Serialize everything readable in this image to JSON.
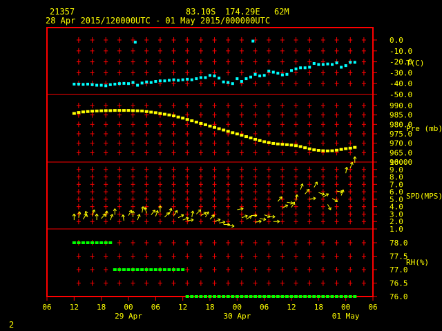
{
  "header": {
    "station_id": "21357",
    "latitude": "83.10S",
    "longitude": "174.29E",
    "elevation": "62M",
    "time_range": "28 Apr 2015/120000UTC - 01 May 2015/000000UTC"
  },
  "page_number": "2",
  "colors": {
    "frame": "#ff0000",
    "grid": "#ff0000",
    "tick_text": "#ffff00",
    "temperature": "#00ffff",
    "pressure": "#ffff00",
    "wind": "#ffff00",
    "humidity": "#00ff00"
  },
  "chart_data": {
    "type": "scatter",
    "x_axis": {
      "unit": "hours since 28 Apr 2015 00UTC",
      "range": [
        6,
        78
      ],
      "tick_values": [
        6,
        12,
        18,
        24,
        30,
        36,
        42,
        48,
        54,
        60,
        66,
        72,
        78
      ],
      "tick_labels": [
        "06",
        "12",
        "18",
        "00",
        "06",
        "12",
        "18",
        "00",
        "06",
        "12",
        "18",
        "00",
        "06"
      ],
      "date_labels": [
        {
          "text": "29 Apr",
          "x": 24
        },
        {
          "text": "30 Apr",
          "x": 48
        },
        {
          "text": "01 May",
          "x": 72
        }
      ]
    },
    "panels": [
      {
        "id": "temperature",
        "label": "T(C)",
        "ylim": [
          -50,
          0
        ],
        "tick_labels": [
          "0.0",
          "-10.0",
          "-20.0",
          "-30.0",
          "-40.0",
          "-50.0"
        ],
        "tick_values": [
          0,
          -10,
          -20,
          -30,
          -40,
          -50
        ],
        "series": [
          [
            12,
            -40.5
          ],
          [
            13,
            -40.5
          ],
          [
            14,
            -40.8
          ],
          [
            15,
            -40.5
          ],
          [
            16,
            -41
          ],
          [
            17,
            -41.5
          ],
          [
            18,
            -41.5
          ],
          [
            19,
            -42
          ],
          [
            20,
            -41
          ],
          [
            21,
            -40.5
          ],
          [
            22,
            -40
          ],
          [
            23,
            -39.8
          ],
          [
            24,
            -40
          ],
          [
            25,
            -39
          ],
          [
            25.5,
            -2
          ],
          [
            26,
            -41.5
          ],
          [
            27,
            -39.5
          ],
          [
            28,
            -38.5
          ],
          [
            29,
            -39
          ],
          [
            30,
            -38
          ],
          [
            31,
            -37.5
          ],
          [
            32,
            -37.5
          ],
          [
            33,
            -37
          ],
          [
            34,
            -36.5
          ],
          [
            35,
            -37
          ],
          [
            36,
            -36.5
          ],
          [
            37,
            -36
          ],
          [
            38,
            -36.5
          ],
          [
            39,
            -35.5
          ],
          [
            40,
            -34.5
          ],
          [
            41,
            -34.5
          ],
          [
            42,
            -32.5
          ],
          [
            43,
            -33
          ],
          [
            44,
            -35
          ],
          [
            45,
            -38.5
          ],
          [
            46,
            -39
          ],
          [
            47,
            -40
          ],
          [
            48,
            -35.5
          ],
          [
            49,
            -38
          ],
          [
            50,
            -35.5
          ],
          [
            51,
            -34
          ],
          [
            51.5,
            -1
          ],
          [
            52,
            -31.5
          ],
          [
            53,
            -33
          ],
          [
            54,
            -32.5
          ],
          [
            55,
            -28.5
          ],
          [
            56,
            -29.5
          ],
          [
            57,
            -30.5
          ],
          [
            58,
            -32
          ],
          [
            59,
            -31.5
          ],
          [
            60,
            -28
          ],
          [
            61,
            -26.5
          ],
          [
            62,
            -25.5
          ],
          [
            63,
            -25.5
          ],
          [
            64,
            -25
          ],
          [
            65,
            -21.5
          ],
          [
            66,
            -22.5
          ],
          [
            67,
            -22.5
          ],
          [
            68,
            -22
          ],
          [
            69,
            -22.5
          ],
          [
            70,
            -21
          ],
          [
            71,
            -25
          ],
          [
            72,
            -23.5
          ],
          [
            73,
            -20.5
          ],
          [
            74,
            -20.5
          ]
        ]
      },
      {
        "id": "pressure",
        "label": "Pre (mb)",
        "ylim": [
          955,
          995
        ],
        "tick_labels": [
          "990.0",
          "985.0",
          "980.0",
          "975.0",
          "970.0",
          "965.0",
          "960.0"
        ],
        "tick_values": [
          990,
          985,
          980,
          975,
          970,
          965,
          960
        ],
        "series": [
          [
            12,
            985.8
          ],
          [
            13,
            986.3
          ],
          [
            14,
            986.6
          ],
          [
            15,
            986.8
          ],
          [
            16,
            987
          ],
          [
            17,
            987.1
          ],
          [
            18,
            987.2
          ],
          [
            19,
            987.3
          ],
          [
            20,
            987.3
          ],
          [
            21,
            987.4
          ],
          [
            22,
            987.4
          ],
          [
            23,
            987.4
          ],
          [
            24,
            987.4
          ],
          [
            25,
            987.3
          ],
          [
            26,
            987.2
          ],
          [
            27,
            987.1
          ],
          [
            28,
            986.8
          ],
          [
            29,
            986.5
          ],
          [
            30,
            986.2
          ],
          [
            31,
            985.8
          ],
          [
            32,
            985.4
          ],
          [
            33,
            985
          ],
          [
            34,
            984.5
          ],
          [
            35,
            983.9
          ],
          [
            36,
            983.3
          ],
          [
            37,
            982.6
          ],
          [
            38,
            981.9
          ],
          [
            39,
            981.2
          ],
          [
            40,
            980.5
          ],
          [
            41,
            979.8
          ],
          [
            42,
            979.1
          ],
          [
            43,
            978.4
          ],
          [
            44,
            977.7
          ],
          [
            45,
            977
          ],
          [
            46,
            976.3
          ],
          [
            47,
            975.6
          ],
          [
            48,
            974.9
          ],
          [
            49,
            974.2
          ],
          [
            50,
            973.5
          ],
          [
            51,
            972.8
          ],
          [
            52,
            972.1
          ],
          [
            53,
            971.4
          ],
          [
            54,
            970.8
          ],
          [
            55,
            970.3
          ],
          [
            56,
            969.9
          ],
          [
            57,
            969.6
          ],
          [
            58,
            969.4
          ],
          [
            59,
            969.2
          ],
          [
            60,
            969
          ],
          [
            61,
            968.7
          ],
          [
            62,
            968.2
          ],
          [
            63,
            967.6
          ],
          [
            64,
            967
          ],
          [
            65,
            966.5
          ],
          [
            66,
            966.2
          ],
          [
            67,
            966
          ],
          [
            68,
            965.9
          ],
          [
            69,
            966
          ],
          [
            70,
            966.3
          ],
          [
            71,
            966.7
          ],
          [
            72,
            967.1
          ],
          [
            73,
            967.4
          ],
          [
            74,
            967.8
          ]
        ]
      },
      {
        "id": "wind",
        "label": "SPD(MPS)",
        "ylim": [
          0.5,
          10.5
        ],
        "tick_labels": [
          "10.0",
          "9.0",
          "8.0",
          "7.0",
          "6.0",
          "5.0",
          "4.0",
          "3.0",
          "2.0",
          "1.0"
        ],
        "tick_values": [
          10,
          9,
          8,
          7,
          6,
          5,
          4,
          3,
          2,
          1
        ],
        "series": [
          [
            12,
            2.2,
            0
          ],
          [
            13,
            2.5,
            10
          ],
          [
            14,
            2.3,
            30
          ],
          [
            15,
            2.6,
            -20
          ],
          [
            16,
            2.8,
            20
          ],
          [
            17,
            2.2,
            0
          ],
          [
            18,
            2.4,
            40
          ],
          [
            19,
            2.6,
            10
          ],
          [
            20,
            2.2,
            20
          ],
          [
            21,
            2.9,
            0
          ],
          [
            23,
            2.1,
            -10
          ],
          [
            24,
            2.8,
            30
          ],
          [
            25,
            2.6,
            0
          ],
          [
            26,
            2.2,
            20
          ],
          [
            27,
            3.2,
            10
          ],
          [
            28,
            3.1,
            -15
          ],
          [
            29,
            2.9,
            40
          ],
          [
            30,
            2.7,
            20
          ],
          [
            31,
            3.3,
            0
          ],
          [
            32,
            2.6,
            45
          ],
          [
            33,
            3.0,
            20
          ],
          [
            34,
            2.8,
            35
          ],
          [
            35,
            2.5,
            60
          ],
          [
            36,
            2.2,
            70
          ],
          [
            37,
            2.1,
            80
          ],
          [
            38,
            2.6,
            10
          ],
          [
            39,
            3.0,
            45
          ],
          [
            40,
            2.8,
            60
          ],
          [
            41,
            2.6,
            30
          ],
          [
            42,
            2.3,
            45
          ],
          [
            43,
            2.0,
            70
          ],
          [
            44,
            1.8,
            80
          ],
          [
            45,
            1.6,
            90
          ],
          [
            46,
            1.5,
            100
          ],
          [
            48,
            3.6,
            80
          ],
          [
            49,
            2.5,
            70
          ],
          [
            50,
            2.3,
            60
          ],
          [
            51,
            2.8,
            90
          ],
          [
            52,
            1.9,
            80
          ],
          [
            53,
            2.4,
            100
          ],
          [
            54,
            2.9,
            110
          ],
          [
            55,
            2.7,
            95
          ],
          [
            56,
            2.0,
            90
          ],
          [
            57,
            4.7,
            40
          ],
          [
            58,
            3.8,
            60
          ],
          [
            59,
            4.6,
            100
          ],
          [
            60,
            3.9,
            30
          ],
          [
            61,
            4.8,
            10
          ],
          [
            62,
            6.3,
            20
          ],
          [
            63,
            5.7,
            40
          ],
          [
            64,
            5.0,
            80
          ],
          [
            65,
            6.6,
            30
          ],
          [
            66,
            5.9,
            110
          ],
          [
            67,
            5.3,
            60
          ],
          [
            68,
            4.3,
            150
          ],
          [
            69,
            5.1,
            120
          ],
          [
            70,
            6.1,
            100
          ],
          [
            71,
            5.5,
            20
          ],
          [
            72,
            8.5,
            10
          ],
          [
            73,
            9.2,
            20
          ],
          [
            74,
            9.9,
            0
          ]
        ]
      },
      {
        "id": "humidity",
        "label": "RH(%)",
        "ylim": [
          75.9,
          78.45
        ],
        "tick_labels": [
          "78.0",
          "77.5",
          "77.0",
          "76.5",
          "76.0"
        ],
        "tick_values": [
          78,
          77.5,
          77,
          76.5,
          76
        ],
        "series": [
          [
            12,
            78
          ],
          [
            13,
            78
          ],
          [
            14,
            78
          ],
          [
            15,
            78
          ],
          [
            16,
            78
          ],
          [
            17,
            78
          ],
          [
            18,
            78
          ],
          [
            19,
            78
          ],
          [
            20,
            78
          ],
          [
            21,
            77
          ],
          [
            22,
            77
          ],
          [
            23,
            77
          ],
          [
            24,
            77
          ],
          [
            25,
            77
          ],
          [
            26,
            77
          ],
          [
            27,
            77
          ],
          [
            28,
            77
          ],
          [
            29,
            77
          ],
          [
            30,
            77
          ],
          [
            31,
            77
          ],
          [
            32,
            77
          ],
          [
            33,
            77
          ],
          [
            34,
            77
          ],
          [
            35,
            77
          ],
          [
            36,
            77
          ],
          [
            37,
            76
          ],
          [
            38,
            76
          ],
          [
            39,
            76
          ],
          [
            40,
            76
          ],
          [
            41,
            76
          ],
          [
            42,
            76
          ],
          [
            43,
            76
          ],
          [
            44,
            76
          ],
          [
            45,
            76
          ],
          [
            46,
            76
          ],
          [
            47,
            76
          ],
          [
            48,
            76
          ],
          [
            49,
            76
          ],
          [
            50,
            76
          ],
          [
            51,
            76
          ],
          [
            52,
            76
          ],
          [
            53,
            76
          ],
          [
            54,
            76
          ],
          [
            55,
            76
          ],
          [
            56,
            76
          ],
          [
            57,
            76
          ],
          [
            58,
            76
          ],
          [
            59,
            76
          ],
          [
            60,
            76
          ],
          [
            61,
            76
          ],
          [
            62,
            76
          ],
          [
            63,
            76
          ],
          [
            64,
            76
          ],
          [
            65,
            76
          ],
          [
            66,
            76
          ],
          [
            67,
            76
          ],
          [
            68,
            76
          ],
          [
            69,
            76
          ],
          [
            70,
            76
          ],
          [
            71,
            76
          ],
          [
            72,
            76
          ],
          [
            73,
            76
          ],
          [
            74,
            76
          ]
        ]
      }
    ]
  }
}
